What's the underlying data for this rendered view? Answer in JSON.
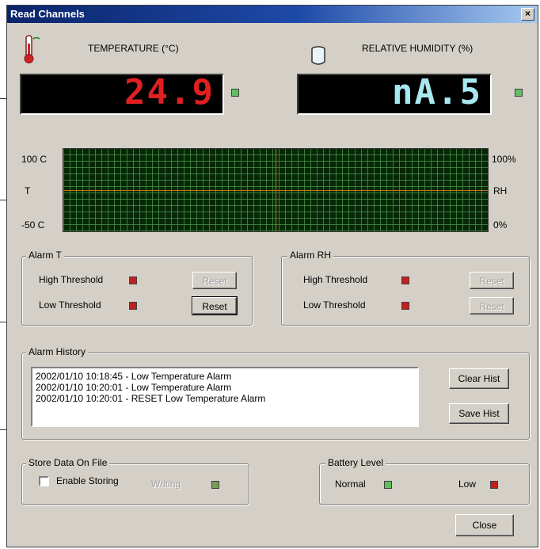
{
  "window": {
    "title": "Read Channels",
    "close_glyph": "×"
  },
  "temperature": {
    "label": "TEMPERATURE (°C)",
    "value": "24.9",
    "icon": "thermometer-icon",
    "color": "#e02020"
  },
  "humidity": {
    "label": "RELATIVE HUMIDITY (%)",
    "value": "nA.5",
    "icon": "beaker-icon",
    "color": "#a8e8f0"
  },
  "graph": {
    "left_top": "100 C",
    "left_mid": "T",
    "left_bottom": "-50 C",
    "right_top": "100%",
    "right_mid": "RH",
    "right_bottom": "0%"
  },
  "alarm_t": {
    "title": "Alarm T",
    "high_label": "High Threshold",
    "low_label": "Low Threshold",
    "high_reset": "Reset",
    "low_reset": "Reset",
    "led_color": "#c02020"
  },
  "alarm_rh": {
    "title": "Alarm RH",
    "high_label": "High Threshold",
    "low_label": "Low Threshold",
    "high_reset": "Reset",
    "low_reset": "Reset",
    "led_color": "#c02020"
  },
  "history": {
    "title": "Alarm History",
    "entries": [
      "2002/01/10 10:18:45  - Low Temperature Alarm",
      "2002/01/10 10:20:01  - Low Temperature Alarm",
      "2002/01/10 10:20:01  - RESET Low Temperature Alarm"
    ],
    "clear_label": "Clear Hist",
    "save_label": "Save Hist"
  },
  "store": {
    "title": "Store Data On File",
    "enable_label": "Enable Storing",
    "writing_label": "Writing",
    "checked": false
  },
  "battery": {
    "title": "Battery Level",
    "normal_label": "Normal",
    "low_label": "Low",
    "normal_color": "#60c060",
    "low_color": "#c02020"
  },
  "close_label": "Close"
}
